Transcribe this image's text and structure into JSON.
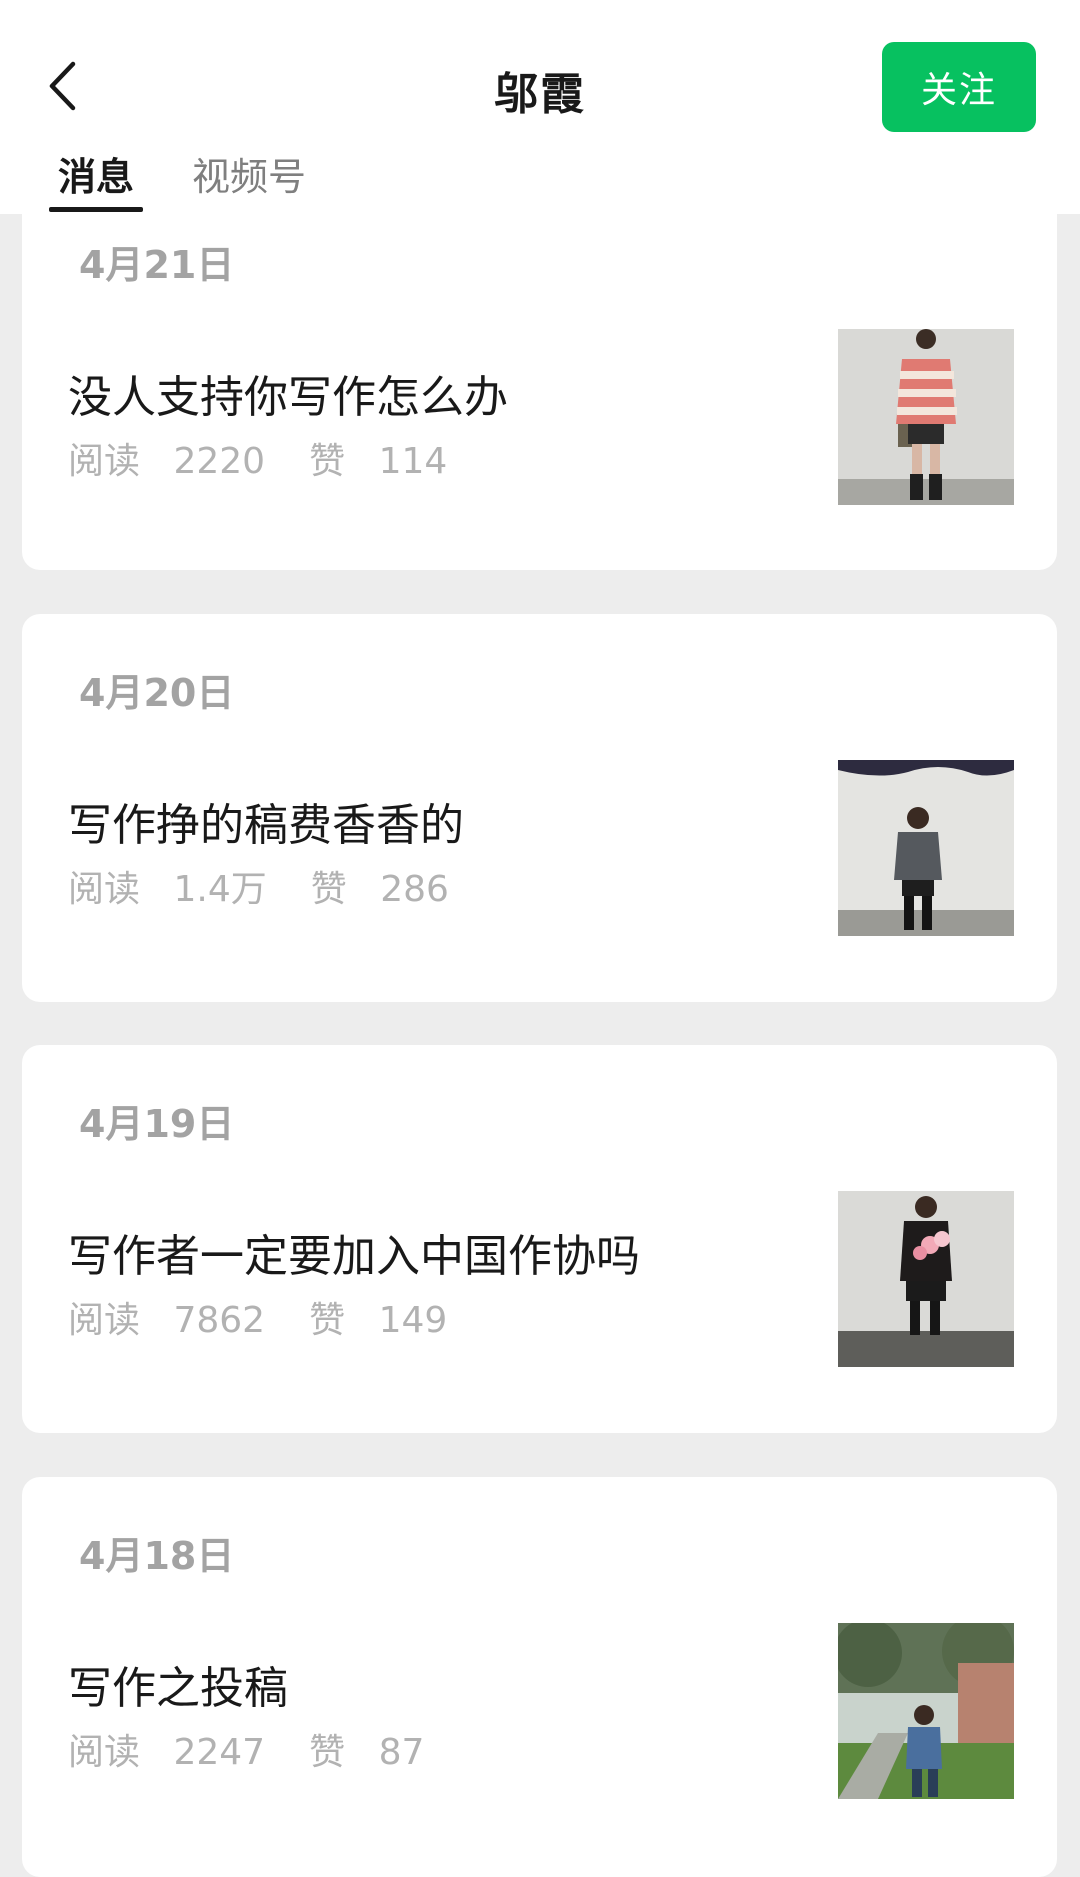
{
  "header": {
    "title": "邬霞",
    "follow_label": "关注",
    "back_icon": "chevron-left-icon"
  },
  "tabs": [
    {
      "label": "消息",
      "active": true
    },
    {
      "label": "视频号",
      "active": false
    }
  ],
  "colors": {
    "accent": "#07c160",
    "background": "#ededed",
    "text_primary": "#191919",
    "text_secondary": "#b2b2b2"
  },
  "articles": [
    {
      "date": "4月21日",
      "title": "没人支持你写作怎么办",
      "reads_label": "阅读",
      "reads": "2220",
      "likes_label": "赞",
      "likes": "114",
      "thumbnail": "photo-woman-striped-sweater"
    },
    {
      "date": "4月20日",
      "title": "写作挣的稿费香香的",
      "reads_label": "阅读",
      "reads": "1.4万",
      "likes_label": "赞",
      "likes": "286",
      "thumbnail": "photo-woman-grey-jacket"
    },
    {
      "date": "4月19日",
      "title": "写作者一定要加入中国作协吗",
      "reads_label": "阅读",
      "reads": "7862",
      "likes_label": "赞",
      "likes": "149",
      "thumbnail": "photo-woman-with-flowers"
    },
    {
      "date": "4月18日",
      "title": "写作之投稿",
      "reads_label": "阅读",
      "reads": "2247",
      "likes_label": "赞",
      "likes": "87",
      "thumbnail": "photo-woman-street-trees"
    }
  ]
}
